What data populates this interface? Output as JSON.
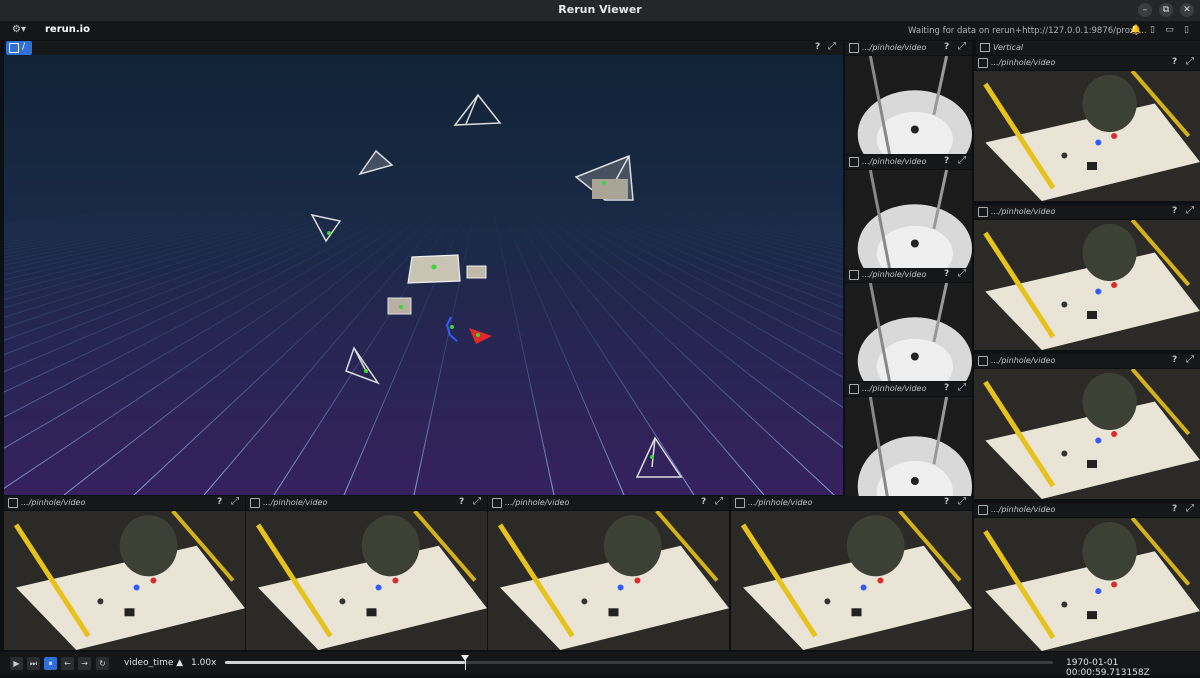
{
  "window": {
    "title": "Rerun Viewer",
    "minimize": "–",
    "restore": "⧉",
    "close": "✕"
  },
  "topbar": {
    "brand": "rerun.io",
    "menu": "⚙▾",
    "status": "Waiting for data on rerun+http://127.0.0.1:9876/proxy..."
  },
  "main_view": {
    "label": "/",
    "help": "?",
    "maximize": "⤢"
  },
  "side_views": [
    {
      "label": ".../pinhole/video"
    },
    {
      "label": ".../pinhole/video"
    },
    {
      "label": ".../pinhole/video"
    },
    {
      "label": ".../pinhole/video"
    }
  ],
  "vertical": {
    "label": "Vertical"
  },
  "vertical_views": [
    {
      "label": ".../pinhole/video"
    },
    {
      "label": ".../pinhole/video"
    },
    {
      "label": ".../pinhole/video"
    },
    {
      "label": ".../pinhole/video"
    }
  ],
  "bottom_views": [
    {
      "label": ".../pinhole/video"
    },
    {
      "label": ".../pinhole/video"
    },
    {
      "label": ".../pinhole/video"
    },
    {
      "label": ".../pinhole/video"
    }
  ],
  "timeline": {
    "timeline_name": "video_time ▲",
    "speed": "1.00x",
    "time": "1970-01-01 00:00:59.713158Z",
    "position": 0.29
  },
  "colors": {
    "accent": "#2f6fd6",
    "background": "#0d1012"
  }
}
